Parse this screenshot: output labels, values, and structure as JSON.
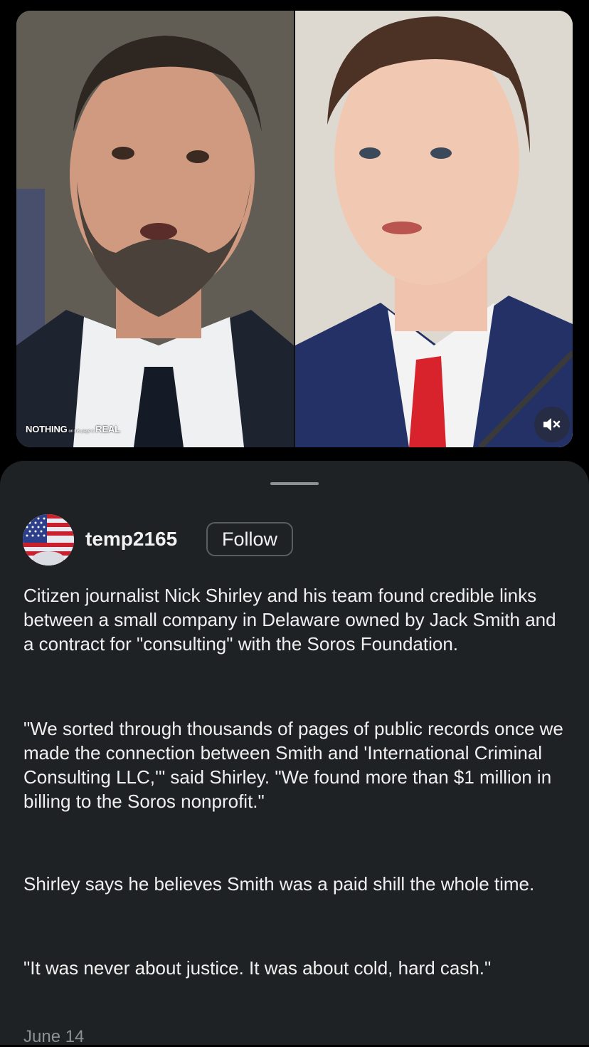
{
  "media": {
    "watermark": {
      "part1": "NOTHING",
      "part2": "on this page is",
      "part3": "REAL"
    },
    "mute_icon": "speaker-muted-icon"
  },
  "post": {
    "username": "temp2165",
    "follow_label": "Follow",
    "avatar_icon": "american-flag-avatar",
    "paragraphs": [
      "Citizen journalist Nick Shirley and his team found credible links between a small company in Delaware owned by Jack Smith and a contract for \"consulting\" with the Soros Foundation.",
      "\"We sorted through thousands of pages of public records once we made the connection between Smith and 'International Criminal Consulting LLC,'\" said Shirley. \"We found more than $1 million in billing to the Soros nonprofit.\"",
      "Shirley says he believes Smith was a paid shill the whole time.",
      "\"It was never about justice. It was about cold, hard cash.\""
    ],
    "date": "June 14"
  },
  "colors": {
    "background": "#000000",
    "sheet": "#1f2224",
    "text": "#f0f0f0",
    "muted_text": "#8d9194"
  }
}
